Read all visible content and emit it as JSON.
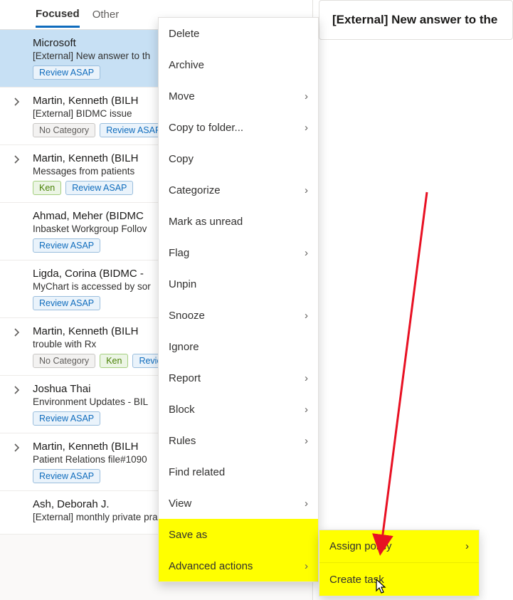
{
  "tabs": {
    "focused": "Focused",
    "other": "Other"
  },
  "reading_pane": {
    "title": "[External] New answer to the"
  },
  "messages": [
    {
      "sender": "Microsoft",
      "subject": "[External] New answer to th",
      "tags": [
        {
          "k": "review",
          "t": "Review ASAP"
        }
      ],
      "expandable": false
    },
    {
      "sender": "Martin, Kenneth (BILH",
      "subject": "[External] BIDMC issue",
      "tags": [
        {
          "k": "nocat",
          "t": "No Category"
        },
        {
          "k": "review",
          "t": "Review ASAP"
        }
      ],
      "expandable": true
    },
    {
      "sender": "Martin, Kenneth (BILH",
      "subject": "Messages from patients",
      "tags": [
        {
          "k": "ken",
          "t": "Ken"
        },
        {
          "k": "review",
          "t": "Review ASAP"
        }
      ],
      "expandable": true
    },
    {
      "sender": "Ahmad, Meher (BIDMC",
      "subject": "Inbasket Workgroup Follov",
      "tags": [
        {
          "k": "review",
          "t": "Review ASAP"
        }
      ],
      "expandable": false
    },
    {
      "sender": "Ligda, Corina (BIDMC -",
      "subject": "MyChart is accessed by sor",
      "tags": [
        {
          "k": "review",
          "t": "Review ASAP"
        }
      ],
      "expandable": false
    },
    {
      "sender": "Martin, Kenneth (BILH",
      "subject": "trouble with Rx",
      "tags": [
        {
          "k": "nocat",
          "t": "No Category"
        },
        {
          "k": "ken",
          "t": "Ken"
        },
        {
          "k": "review",
          "t": "Reviev"
        }
      ],
      "expandable": true
    },
    {
      "sender": "Joshua Thai",
      "subject": "Environment Updates - BIL",
      "tags": [
        {
          "k": "review",
          "t": "Review ASAP"
        }
      ],
      "expandable": true
    },
    {
      "sender": "Martin, Kenneth (BILH",
      "subject": "Patient Relations file#1090",
      "tags": [
        {
          "k": "review",
          "t": "Review ASAP"
        }
      ],
      "expandable": true
    },
    {
      "sender": "Ash, Deborah J.",
      "subject": "[External] monthly private practice foru",
      "tags": [],
      "expandable": false
    }
  ],
  "menu": {
    "delete": "Delete",
    "archive": "Archive",
    "move": "Move",
    "copy_to_folder": "Copy to folder...",
    "copy": "Copy",
    "categorize": "Categorize",
    "mark_unread": "Mark as unread",
    "flag": "Flag",
    "unpin": "Unpin",
    "snooze": "Snooze",
    "ignore": "Ignore",
    "report": "Report",
    "block": "Block",
    "rules": "Rules",
    "find_related": "Find related",
    "view": "View",
    "save_as": "Save as",
    "advanced_actions": "Advanced actions"
  },
  "submenu": {
    "assign_policy": "Assign policy",
    "create_task": "Create task"
  }
}
